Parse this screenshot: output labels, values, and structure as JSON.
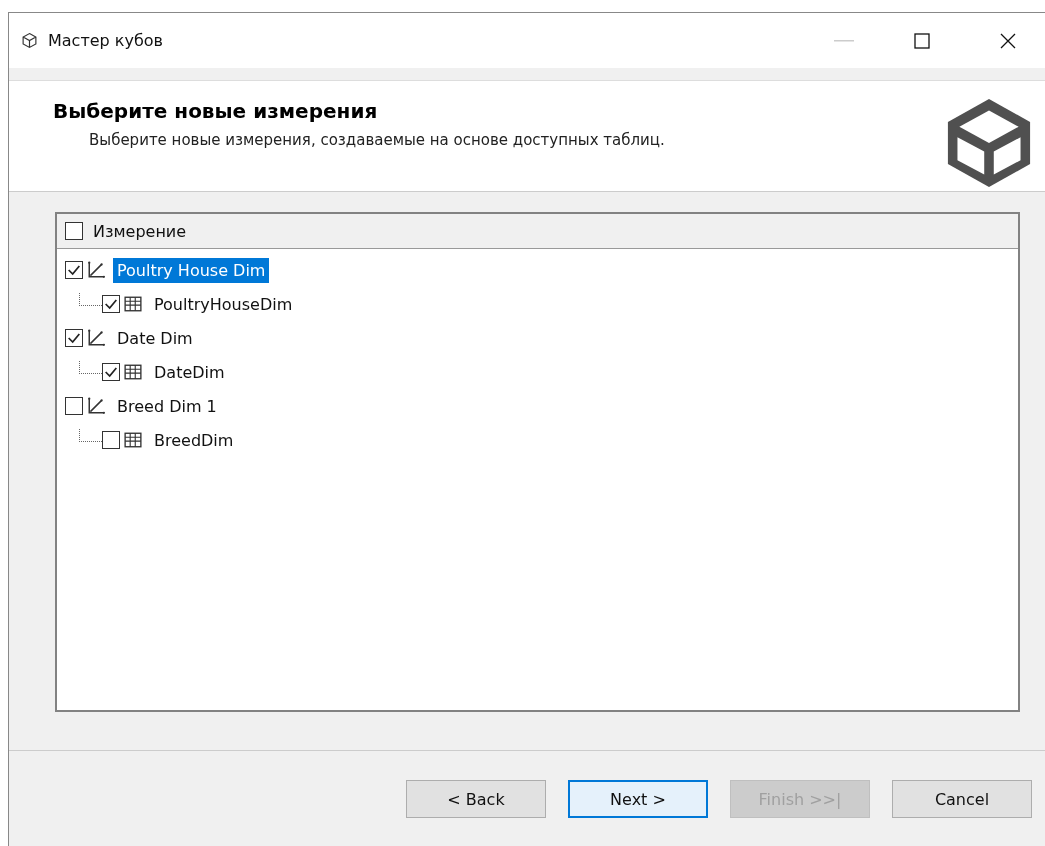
{
  "window": {
    "title": "Мастер кубов"
  },
  "header": {
    "title": "Выберите новые измерения",
    "subtitle": "Выберите новые измерения, создаваемые на основе доступных таблиц."
  },
  "tree": {
    "column": {
      "label": "Измерение",
      "checked": false
    },
    "items": [
      {
        "label": "Poultry House Dim",
        "checked": true,
        "selected": true,
        "children": [
          {
            "label": "PoultryHouseDim",
            "checked": true,
            "selected": false
          }
        ]
      },
      {
        "label": "Date Dim",
        "checked": true,
        "selected": false,
        "children": [
          {
            "label": "DateDim",
            "checked": true,
            "selected": false
          }
        ]
      },
      {
        "label": "Breed Dim 1",
        "checked": false,
        "selected": false,
        "children": [
          {
            "label": "BreedDim",
            "checked": false,
            "selected": false
          }
        ]
      }
    ]
  },
  "buttons": [
    {
      "label": "< Back",
      "disabled": false,
      "default": false
    },
    {
      "label": "Next >",
      "disabled": false,
      "default": true
    },
    {
      "label": "Finish >>|",
      "disabled": true,
      "default": false
    },
    {
      "label": "Cancel",
      "disabled": false,
      "default": false
    }
  ]
}
